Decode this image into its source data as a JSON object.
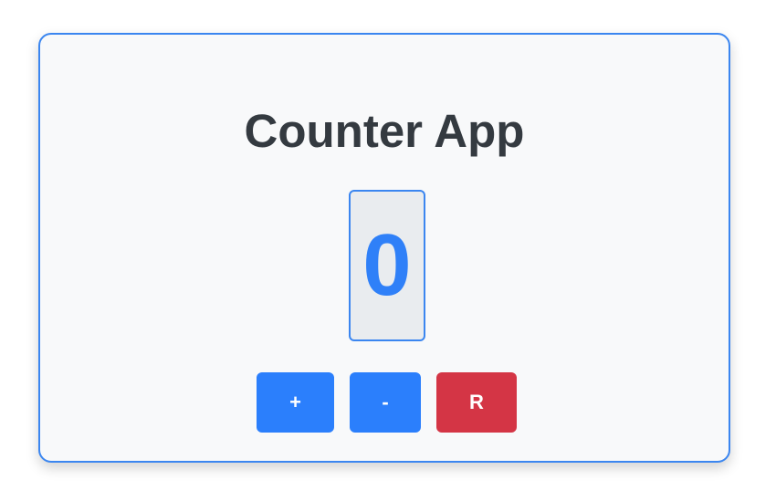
{
  "app": {
    "title": "Counter App"
  },
  "counter": {
    "value": "0"
  },
  "buttons": {
    "increment_label": "+",
    "decrement_label": "-",
    "reset_label": "R"
  },
  "colors": {
    "accent": "#2b7ffc",
    "danger": "#d43545",
    "title_text": "#343a40",
    "card_background": "#f8f9fa",
    "display_background": "#e9ecef"
  }
}
